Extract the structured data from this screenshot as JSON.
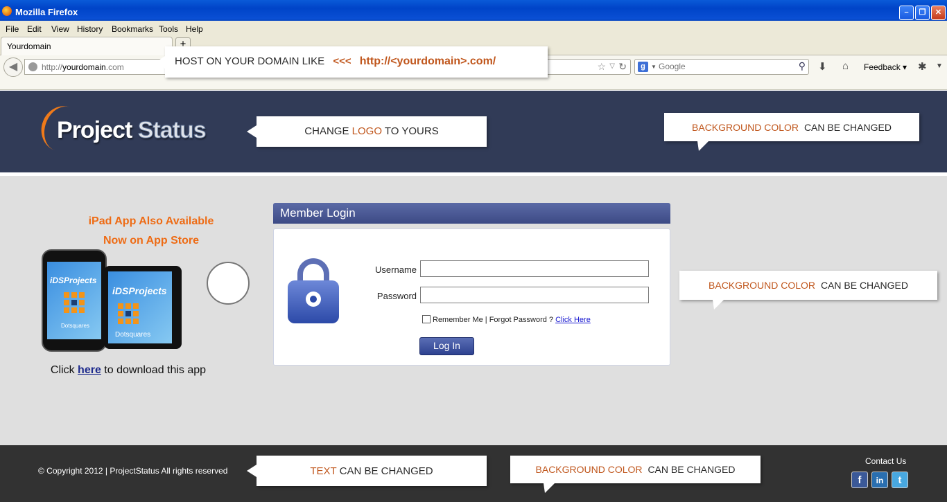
{
  "browser": {
    "window_title": "Mozilla Firefox",
    "menu": [
      "File",
      "Edit",
      "View",
      "History",
      "Bookmarks",
      "Tools",
      "Help"
    ],
    "tab_title": "Yourdomain",
    "new_tab_symbol": "+",
    "url_prefix": "http://",
    "url_domain": "yourdomain",
    "url_suffix": ".com",
    "search_engine_icon": "google-icon",
    "search_placeholder": "Google",
    "feedback_label": "Feedback"
  },
  "callouts": {
    "domain": {
      "text": "HOST ON YOUR DOMAIN LIKE",
      "arrows": "<<<",
      "highlight": "http://<yourdomain>.com/"
    },
    "logo": {
      "pre": "CHANGE",
      "highlight": "LOGO",
      "post": "TO YOURS"
    },
    "header_bg": {
      "highlight": "BACKGROUND COLOR",
      "post": "CAN BE CHANGED"
    },
    "main_bg": {
      "highlight": "BACKGROUND COLOR",
      "post": "CAN BE CHANGED"
    },
    "footer_text": {
      "highlight": "TEXT",
      "post": "CAN BE CHANGED"
    },
    "footer_bg": {
      "highlight": "BACKGROUND COLOR",
      "post": "CAN BE CHANGED"
    }
  },
  "header": {
    "logo_word1": "Project",
    "logo_word2": "Status",
    "background_color": "#313b57"
  },
  "app_promo": {
    "line1": "iPad App Also Available",
    "line2": "Now on App Store",
    "device_label": "DSProjects",
    "device_label_prefix": "i",
    "device_brand": "Dotsquares",
    "click_pre": "Click",
    "click_link": "here",
    "click_post": "to download this app",
    "store_icon": "apple-icon"
  },
  "login": {
    "title": "Member Login",
    "username_label": "Username",
    "password_label": "Password",
    "username_value": "",
    "password_value": "",
    "remember_label": "Remember Me | Forgot Password ?",
    "forgot_link": "Click Here",
    "button_label": "Log In"
  },
  "footer": {
    "copyright": "© Copyright 2012 | ProjectStatus All rights reserved",
    "contact_label": "Contact Us",
    "social": [
      "facebook-icon",
      "linkedin-icon",
      "twitter-icon"
    ],
    "background_color": "#323232"
  },
  "colors": {
    "accent_orange": "#c0561c",
    "promo_orange": "#ee6b14",
    "main_background": "#dfdfdf"
  }
}
